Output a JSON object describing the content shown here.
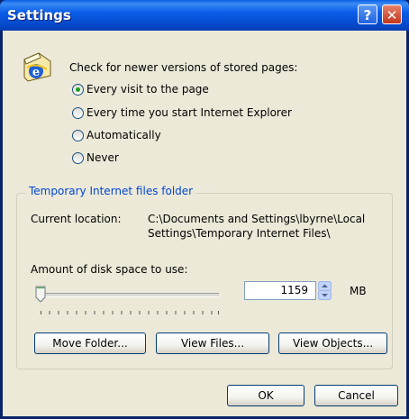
{
  "window": {
    "title": "Settings"
  },
  "check": {
    "prompt": "Check for newer versions of stored pages:",
    "options": [
      "Every visit to the page",
      "Every time you start Internet Explorer",
      "Automatically",
      "Never"
    ],
    "selected": "Every visit to the page"
  },
  "temp_folder": {
    "legend": "Temporary Internet files folder",
    "location_label": "Current location:",
    "location_line1": "C:\\Documents and Settings\\lbyrne\\Local",
    "location_line2": "Settings\\Temporary Internet Files\\",
    "disk_label": "Amount of disk space to use:",
    "disk_value": "1159",
    "unit": "MB",
    "move_label": "Move Folder...",
    "view_files_label": "View Files...",
    "view_objects_label": "View Objects..."
  },
  "footer": {
    "ok_label": "OK",
    "cancel_label": "Cancel"
  },
  "colors": {
    "title_blue": "#0a5fe4",
    "radio_dot": "#21a121",
    "legend_blue": "#0046d5"
  }
}
